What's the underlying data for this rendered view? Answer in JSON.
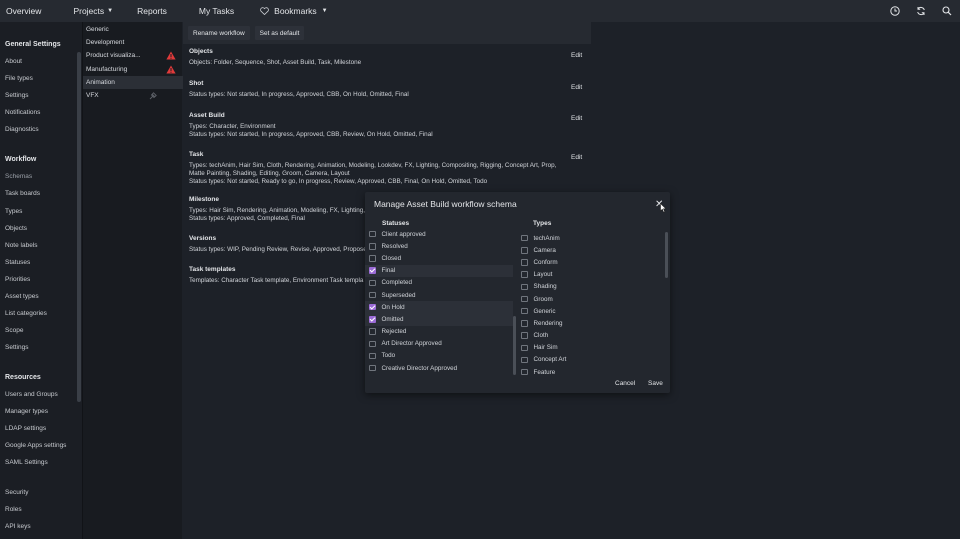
{
  "topnav": {
    "overview": "Overview",
    "projects": "Projects",
    "reports": "Reports",
    "my_tasks": "My Tasks",
    "bookmarks": "Bookmarks"
  },
  "sidebar": {
    "general_heading": "General Settings",
    "general_items": [
      "About",
      "File types",
      "Settings",
      "Notifications",
      "Diagnostics"
    ],
    "workflow_heading": "Workflow",
    "workflow_items": [
      "Schemas",
      "Task boards",
      "Types",
      "Objects",
      "Note labels",
      "Statuses",
      "Priorities",
      "Asset types",
      "List categories",
      "Scope",
      "Settings"
    ],
    "resources_heading": "Resources",
    "resources_items": [
      "Users and Groups",
      "Manager types",
      "LDAP settings",
      "Google Apps settings",
      "SAML Settings"
    ],
    "security_items": [
      "Security",
      "Roles",
      "API keys"
    ]
  },
  "schemas": [
    "Generic",
    "Development",
    "Product visualiza...",
    "Manufacturing",
    "Animation",
    "VFX"
  ],
  "toolbar": {
    "rename": "Rename workflow",
    "default": "Set as default"
  },
  "sections": {
    "objects": {
      "title": "Objects",
      "l1": "Objects: Folder, Sequence, Shot, Asset Build, Task, Milestone"
    },
    "shot": {
      "title": "Shot",
      "l1": "Status types: Not started, In progress, Approved, CBB, On Hold, Omitted, Final"
    },
    "asset": {
      "title": "Asset Build",
      "l1": "Types: Character, Environment",
      "l2": "Status types: Not started, In progress, Approved, CBB, Review, On Hold, Omitted, Final"
    },
    "task": {
      "title": "Task",
      "l1": "Types: techAnim, Hair Sim, Cloth, Rendering, Animation, Modeling, Lookdev, FX, Lighting, Compositing, Rigging, Concept Art, Prop,",
      "l2": "Matte Painting, Shading, Editing, Groom, Camera, Layout",
      "l3": "Status types: Not started, Ready to go, In progress, Review, Approved, CBB, Final, On Hold, Omitted, Todo"
    },
    "milestone": {
      "title": "Milestone",
      "l1": "Types: Hair Sim, Rendering, Animation, Modeling, FX, Lighting,",
      "l2": "Status types: Approved, Completed, Final"
    },
    "versions": {
      "title": "Versions",
      "l1": "Status types: WIP, Pending Review, Revise, Approved, Proposed"
    },
    "templates": {
      "title": "Task templates",
      "l1": "Templates: Character Task template, Environment Task templa"
    },
    "edit": "Edit"
  },
  "modal": {
    "title": "Manage Asset Build workflow schema",
    "statuses_heading": "Statuses",
    "types_heading": "Types",
    "cancel": "Cancel",
    "save": "Save",
    "statuses": [
      {
        "label": "Client approved",
        "checked": false
      },
      {
        "label": "Resolved",
        "checked": false
      },
      {
        "label": "Closed",
        "checked": false
      },
      {
        "label": "Final",
        "checked": true
      },
      {
        "label": "Completed",
        "checked": false
      },
      {
        "label": "Superseded",
        "checked": false
      },
      {
        "label": "On Hold",
        "checked": true
      },
      {
        "label": "Omitted",
        "checked": true
      },
      {
        "label": "Rejected",
        "checked": false
      },
      {
        "label": "Art Director Approved",
        "checked": false
      },
      {
        "label": "Todo",
        "checked": false
      },
      {
        "label": "Creative Director Approved",
        "checked": false
      }
    ],
    "types": [
      {
        "label": "techAnim",
        "checked": false
      },
      {
        "label": "Camera",
        "checked": false
      },
      {
        "label": "Conform",
        "checked": false
      },
      {
        "label": "Layout",
        "checked": false
      },
      {
        "label": "Shading",
        "checked": false
      },
      {
        "label": "Groom",
        "checked": false
      },
      {
        "label": "Generic",
        "checked": false
      },
      {
        "label": "Rendering",
        "checked": false
      },
      {
        "label": "Cloth",
        "checked": false
      },
      {
        "label": "Hair Sim",
        "checked": false
      },
      {
        "label": "Concept Art",
        "checked": false
      },
      {
        "label": "Feature",
        "checked": false
      }
    ]
  },
  "colors": {
    "accent": "#9b6bd6",
    "warning": "#e03a3a"
  }
}
